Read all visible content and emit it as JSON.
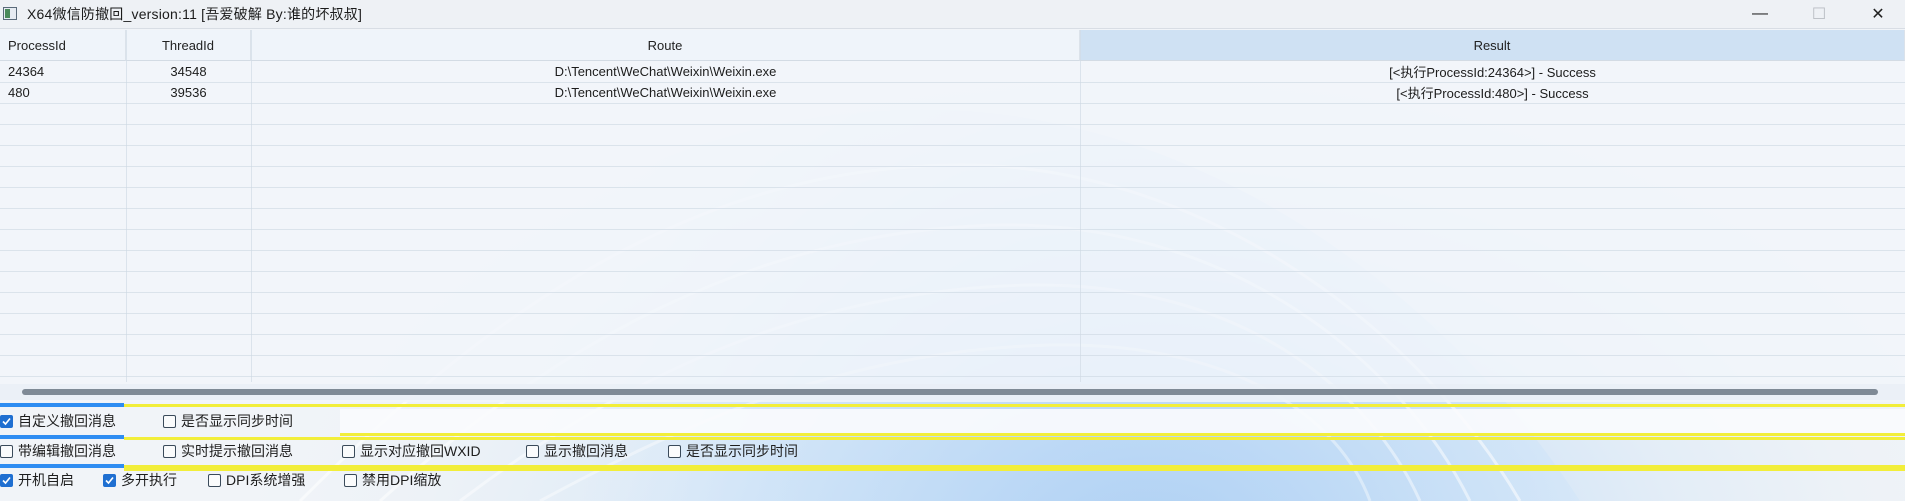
{
  "window": {
    "title": "X64微信防撤回_version:11 [吾爱破解 By:谁的坏叔叔]",
    "controls": {
      "minimize": "—",
      "maximize": "☐",
      "close": "✕"
    }
  },
  "table": {
    "columns": [
      "ProcessId",
      "ThreadId",
      "Route",
      "Result"
    ],
    "selected_column": "Result",
    "rows": [
      {
        "pid": "24364",
        "tid": "34548",
        "route": "D:\\Tencent\\WeChat\\Weixin\\Weixin.exe",
        "result": "[<执行ProcessId:24364>] - Success"
      },
      {
        "pid": "480",
        "tid": "39536",
        "route": "D:\\Tencent\\WeChat\\Weixin\\Weixin.exe",
        "result": "[<执行ProcessId:480>] - Success"
      }
    ]
  },
  "options": {
    "row1": [
      {
        "label": "自定义撤回消息",
        "checked": true
      },
      {
        "label": "是否显示同步时间",
        "checked": false
      }
    ],
    "row2": [
      {
        "label": "带编辑撤回消息",
        "checked": false
      },
      {
        "label": "实时提示撤回消息",
        "checked": false
      },
      {
        "label": "显示对应撤回WXID",
        "checked": false
      },
      {
        "label": "显示撤回消息",
        "checked": false
      },
      {
        "label": "是否显示同步时间",
        "checked": false
      }
    ],
    "row3": [
      {
        "label": "开机自启",
        "checked": true
      },
      {
        "label": "多开执行",
        "checked": true
      },
      {
        "label": "DPI系统增强",
        "checked": false
      },
      {
        "label": "禁用DPI缩放",
        "checked": false
      }
    ]
  },
  "colors": {
    "accent": "#2f8df2",
    "highlight": "#f2ee3a",
    "checked": "#1f6fd1"
  }
}
